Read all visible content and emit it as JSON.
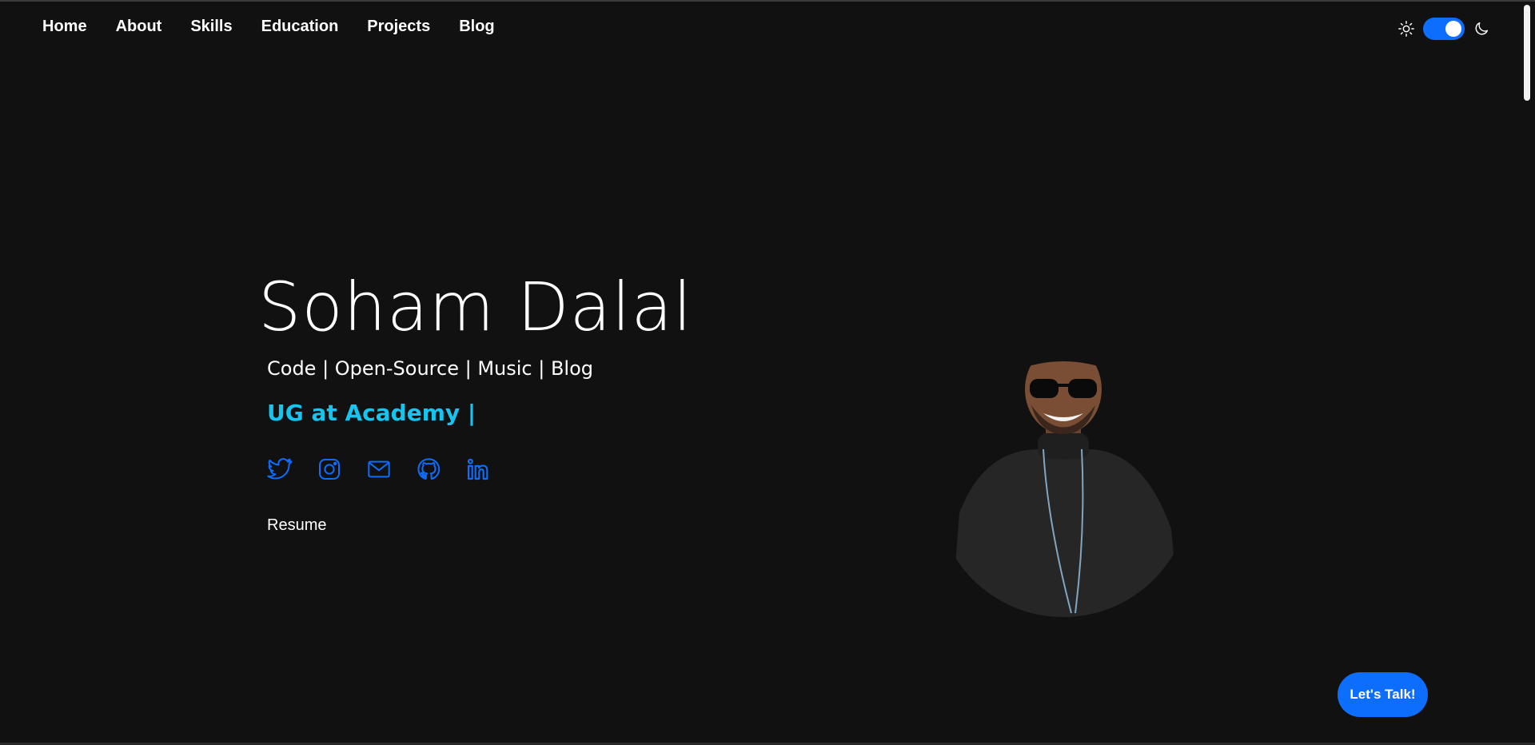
{
  "nav": {
    "items": [
      {
        "label": "Home"
      },
      {
        "label": "About"
      },
      {
        "label": "Skills"
      },
      {
        "label": "Education"
      },
      {
        "label": "Projects"
      },
      {
        "label": "Blog"
      }
    ]
  },
  "theme": {
    "sun_icon": "sun-icon",
    "moon_icon": "moon-icon",
    "dark_mode_on": true,
    "accent": "#0d6efd"
  },
  "hero": {
    "name": "Soham Dalal",
    "tagline": "Code | Open-Source | Music | Blog",
    "role": "UG at Academy |",
    "role_color": "#14c6ef",
    "resume_label": "Resume",
    "socials": [
      {
        "icon": "twitter-icon"
      },
      {
        "icon": "instagram-icon"
      },
      {
        "icon": "mail-icon"
      },
      {
        "icon": "github-icon"
      },
      {
        "icon": "linkedin-icon"
      }
    ]
  },
  "cta": {
    "label": "Let's Talk!"
  },
  "colors": {
    "background": "#111111",
    "text": "#ffffff",
    "icon": "#0d6efd"
  }
}
